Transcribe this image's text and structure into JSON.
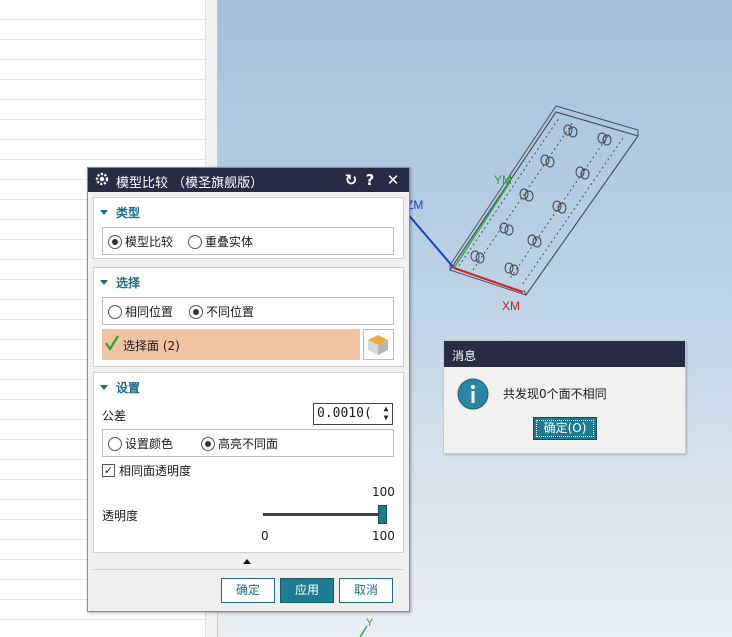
{
  "viewport": {
    "axis_xm": "XM",
    "axis_ym": "YM",
    "axis_zm": "ZM",
    "axis_y": "Y"
  },
  "dialog": {
    "title": "模型比较  （模圣旗舰版）",
    "title_icons": [
      "gear-icon",
      "reset-icon",
      "help-icon",
      "close-icon"
    ],
    "type_section": {
      "header": "类型",
      "options": [
        "模型比较",
        "重叠实体"
      ],
      "selected": "模型比较"
    },
    "select_section": {
      "header": "选择",
      "options": [
        "相同位置",
        "不同位置"
      ],
      "selected": "不同位置",
      "select_face_label": "选择面 (2)"
    },
    "settings_section": {
      "header": "设置",
      "tolerance_label": "公差",
      "tolerance_value": "0.0010(",
      "color_options": [
        "设置颜色",
        "高亮不同面"
      ],
      "color_selected": "高亮不同面",
      "same_face_transparency_label": "相同面透明度",
      "same_face_transparency_checked": true,
      "transparency_label": "透明度",
      "transparency_value": 100,
      "transparency_value_text": "100",
      "slider_min": "0",
      "slider_max": "100"
    },
    "buttons": {
      "ok": "确定",
      "apply": "应用",
      "cancel": "取消"
    }
  },
  "message": {
    "title": "消息",
    "text": "共发现0个面不相同",
    "ok_button": "确定(O)",
    "icon": "info-icon"
  },
  "colors": {
    "title_bar": "#272b44",
    "accent": "#1d7c93",
    "section_header": "#1e6b8c",
    "selection_highlight": "#f1c3a2"
  }
}
